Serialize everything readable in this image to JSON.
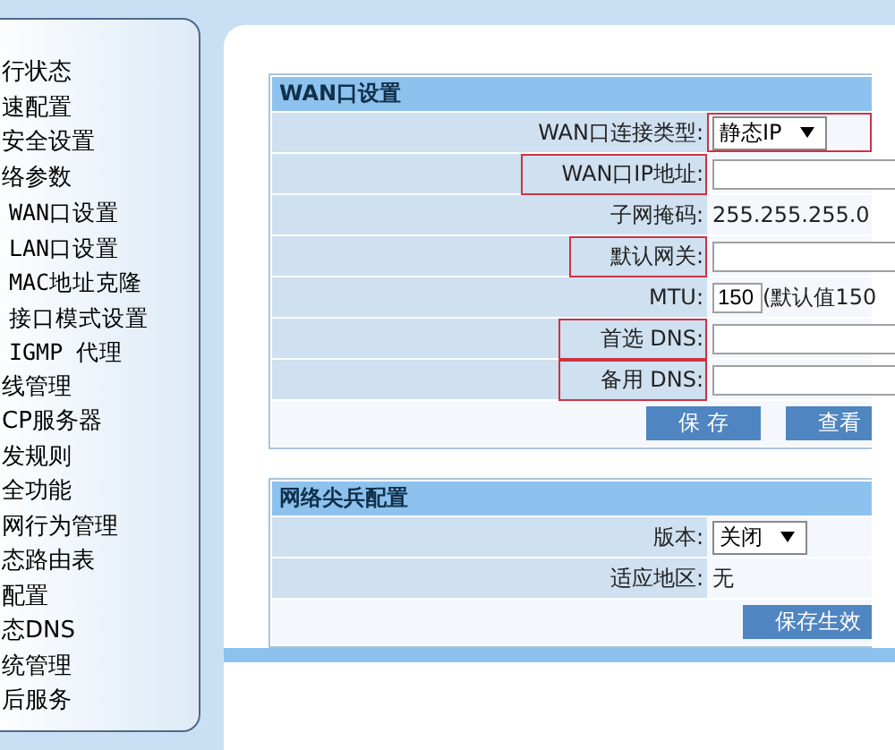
{
  "sidebar": {
    "items": [
      {
        "label": "行状态"
      },
      {
        "label": "速配置"
      },
      {
        "label": "安全设置"
      },
      {
        "label": "络参数",
        "children": [
          {
            "label": "WAN口设置"
          },
          {
            "label": "LAN口设置"
          },
          {
            "label": "MAC地址克隆"
          },
          {
            "label": "接口模式设置"
          },
          {
            "label": "IGMP 代理"
          }
        ]
      },
      {
        "label": "线管理"
      },
      {
        "label": "CP服务器"
      },
      {
        "label": "发规则"
      },
      {
        "label": "全功能"
      },
      {
        "label": "网行为管理"
      },
      {
        "label": "态路由表"
      },
      {
        "label": "配置"
      },
      {
        "label": "态DNS"
      },
      {
        "label": "统管理"
      },
      {
        "label": "后服务"
      }
    ]
  },
  "sections": [
    {
      "title": "WAN口设置",
      "rows": [
        {
          "label": "WAN口连接类型:",
          "kind": "select",
          "value": "静态IP",
          "label_marked": false,
          "value_marked": true
        },
        {
          "label": "WAN口IP地址:",
          "kind": "input",
          "value": "",
          "label_marked": true,
          "value_marked": false
        },
        {
          "label": "子网掩码:",
          "kind": "text",
          "value": "255.255.255.0",
          "label_marked": false,
          "value_marked": false
        },
        {
          "label": "默认网关:",
          "kind": "input",
          "value": "",
          "label_marked": true,
          "value_marked": false
        },
        {
          "label": "MTU:",
          "kind": "short-input",
          "value": "150",
          "note": "(默认值150",
          "label_marked": false,
          "value_marked": false
        },
        {
          "label": "首选 DNS:",
          "kind": "input",
          "value": "",
          "label_marked": true,
          "value_marked": false
        },
        {
          "label": "备用 DNS:",
          "kind": "input",
          "value": "",
          "label_marked": true,
          "value_marked": false
        }
      ],
      "buttons": [
        "保 存",
        "查看"
      ]
    },
    {
      "title": "网络尖兵配置",
      "rows": [
        {
          "label": "版本:",
          "kind": "select",
          "value": "关闭",
          "label_marked": false,
          "value_marked": false
        },
        {
          "label": "适应地区:",
          "kind": "text",
          "value": "无",
          "label_marked": false,
          "value_marked": false
        }
      ],
      "buttons": [
        "保存生效"
      ]
    }
  ]
}
